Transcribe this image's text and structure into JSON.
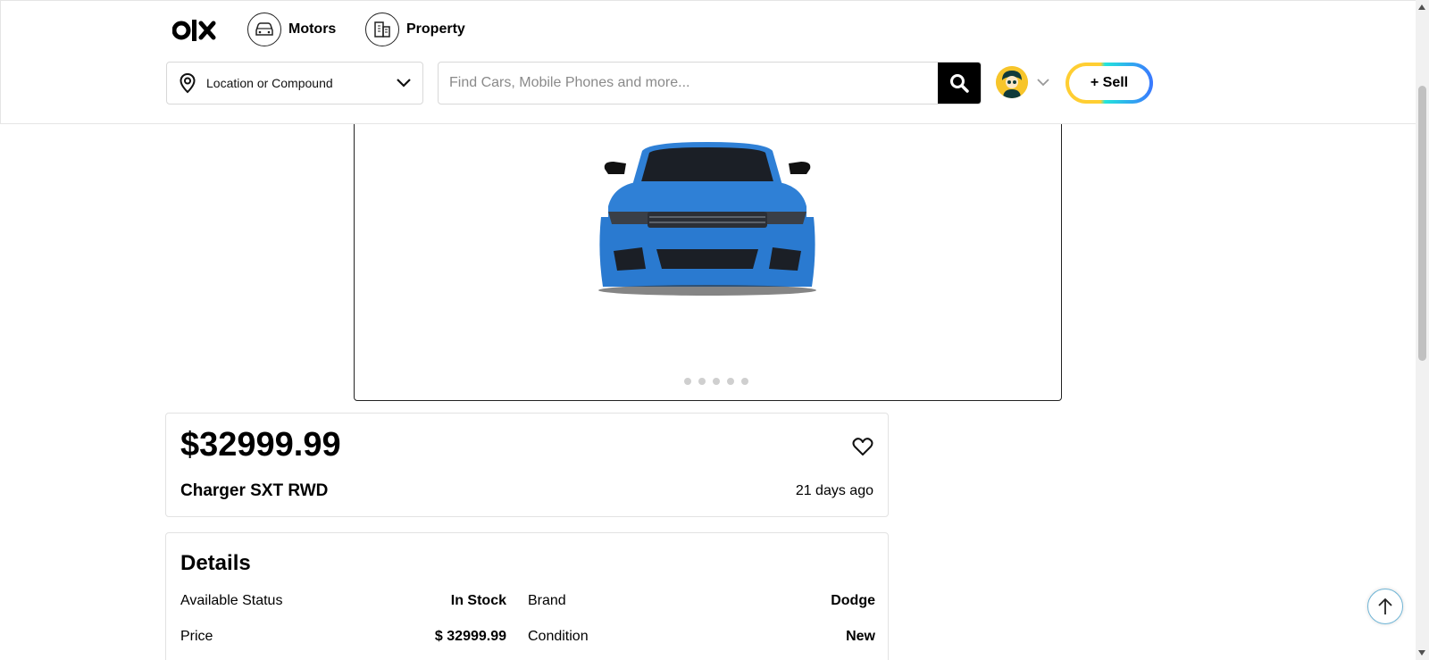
{
  "header": {
    "logo_text": "olx",
    "nav": [
      {
        "label": "Motors",
        "icon": "car-icon"
      },
      {
        "label": "Property",
        "icon": "building-icon"
      }
    ],
    "location": {
      "label": "Location or Compound",
      "icon": "location-pin-icon"
    },
    "search": {
      "placeholder": "Find Cars, Mobile Phones and more...",
      "value": ""
    },
    "sell_label": "+ Sell"
  },
  "gallery": {
    "image_alt": "Blue car front view",
    "total_images": 5,
    "active_index": 0
  },
  "listing": {
    "price": "$32999.99",
    "title": "Charger SXT RWD",
    "posted": "21 days ago"
  },
  "details": {
    "heading": "Details",
    "rows": [
      [
        {
          "label": "Available Status",
          "value": "In Stock"
        },
        {
          "label": "Brand",
          "value": "Dodge"
        }
      ],
      [
        {
          "label": "Price",
          "value": "$ 32999.99"
        },
        {
          "label": "Condition",
          "value": "New"
        }
      ]
    ]
  },
  "colors": {
    "accent_yellow": "#ffce32",
    "accent_teal": "#23e5db",
    "accent_blue": "#3a77ff",
    "search_button": "#000000",
    "car_blue": "#2f80d6"
  }
}
